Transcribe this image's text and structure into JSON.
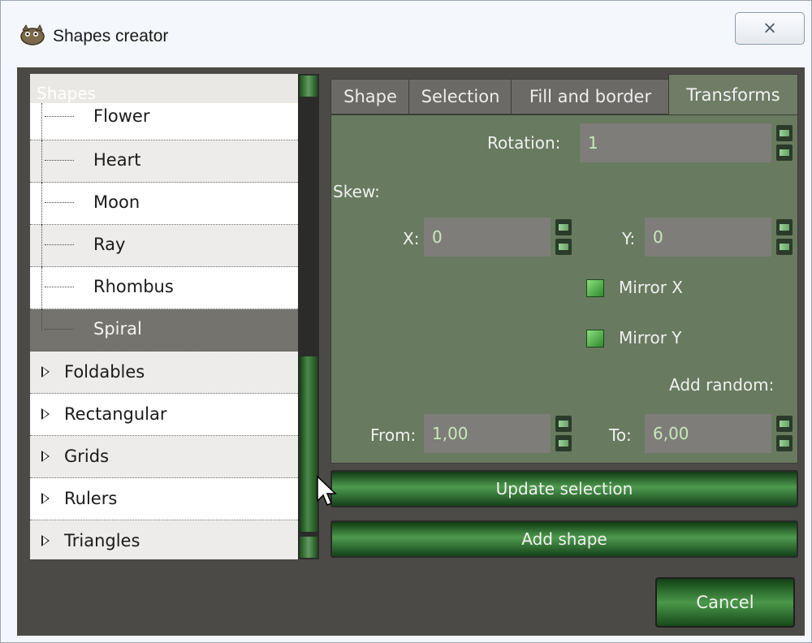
{
  "window": {
    "title": "Shapes creator",
    "close_glyph": "⨯"
  },
  "tree": {
    "header": "Shapes",
    "children": [
      "Flower",
      "Heart",
      "Moon",
      "Ray",
      "Rhombus",
      "Spiral"
    ],
    "selected": "Spiral",
    "categories": [
      "Foldables",
      "Rectangular",
      "Grids",
      "Rulers",
      "Triangles"
    ]
  },
  "tabs": [
    "Shape",
    "Selection",
    "Fill and border",
    "Transforms"
  ],
  "active_tab": "Transforms",
  "transforms": {
    "rotation_label": "Rotation:",
    "rotation_value": "1",
    "skew_label": "Skew:",
    "x_label": "X:",
    "x_value": "0",
    "y_label": "Y:",
    "y_value": "0",
    "mirror_x_label": "Mirror X",
    "mirror_y_label": "Mirror Y",
    "add_random_label": "Add random:",
    "from_label": "From:",
    "from_value": "1,00",
    "to_label": "To:",
    "to_value": "6,00"
  },
  "buttons": {
    "update_selection": "Update selection",
    "add_shape": "Add shape",
    "cancel": "Cancel"
  },
  "colors": {
    "panel_bg": "#687a5f",
    "accent_green": "#4e9a4e",
    "dark_bg": "#4b4a46"
  }
}
